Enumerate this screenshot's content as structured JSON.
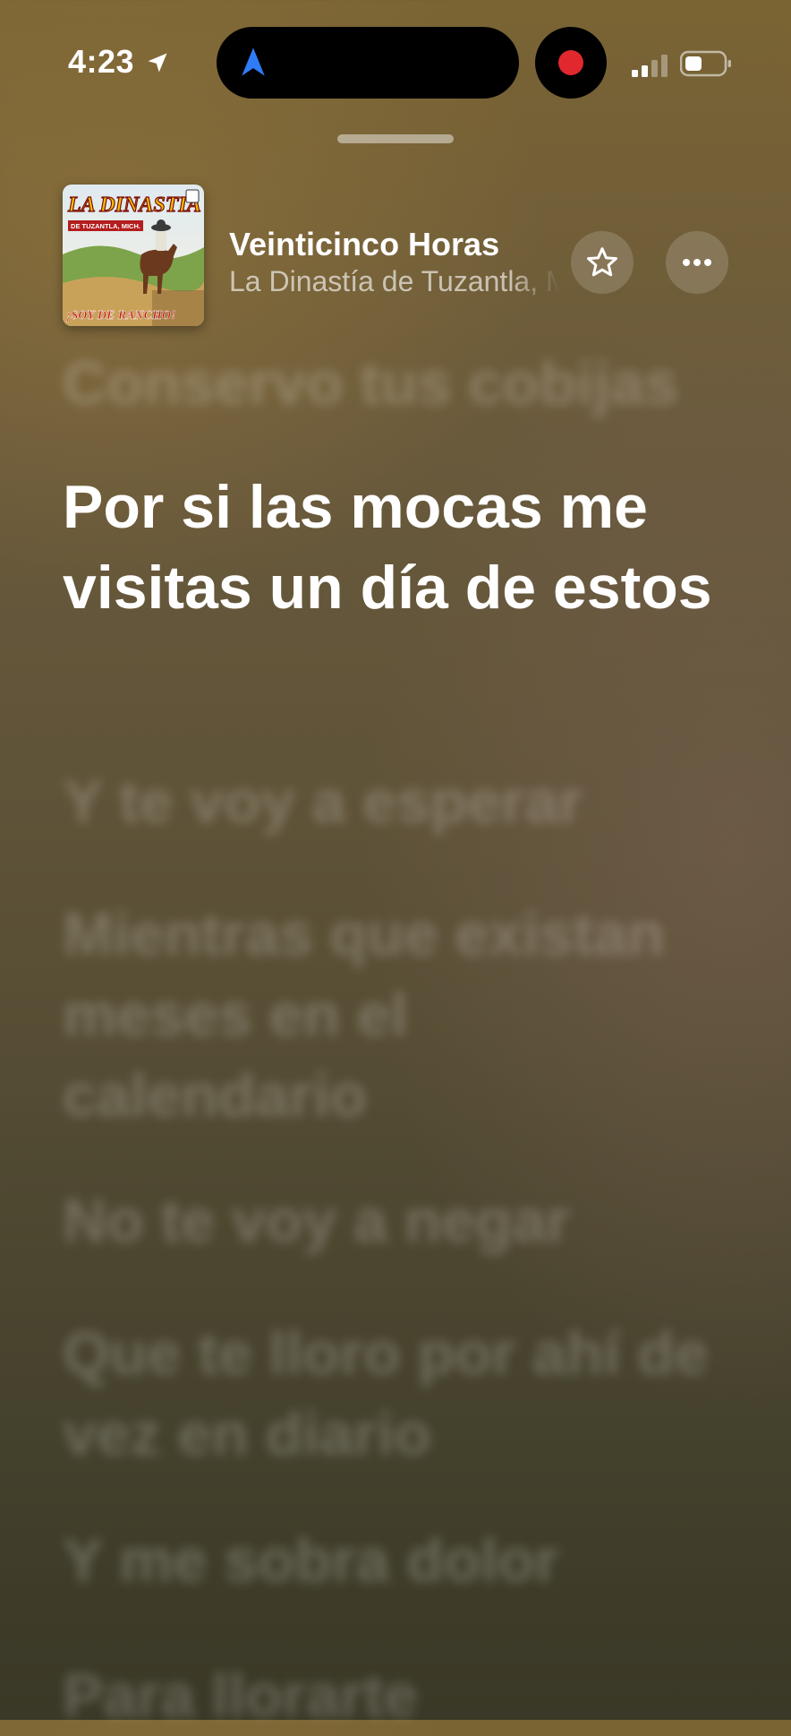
{
  "status_bar": {
    "time": "4:23",
    "icons": [
      "location-arrow-icon",
      "navigation-icon",
      "recording-dot-icon",
      "cellular-signal-icon",
      "battery-icon"
    ]
  },
  "now_playing": {
    "title": "Veinticinco Horas",
    "artist": "La Dinastía de Tuzantla, Mich.",
    "artwork": {
      "brand": "LA DINASTIA",
      "subtitle": "DE TUZANTLA, MICH.",
      "album": "¡SOY DE RANCHO!"
    },
    "favorite_icon": "star-icon",
    "more_icon": "ellipsis-icon"
  },
  "lyrics": {
    "previous": "Conservo tus cobijas",
    "current": "Por si las mocas me visitas un día de estos",
    "upcoming": [
      "Y te voy a esperar",
      "Mientras que existan meses en el calendario",
      "No te voy a negar",
      "Que te lloro por ahí de vez en diario",
      "Y me sobra dolor",
      "Para llorarte"
    ]
  },
  "colors": {
    "recording": "#e0282e",
    "navigation": "#2f7cf6",
    "text_primary": "#ffffff"
  }
}
